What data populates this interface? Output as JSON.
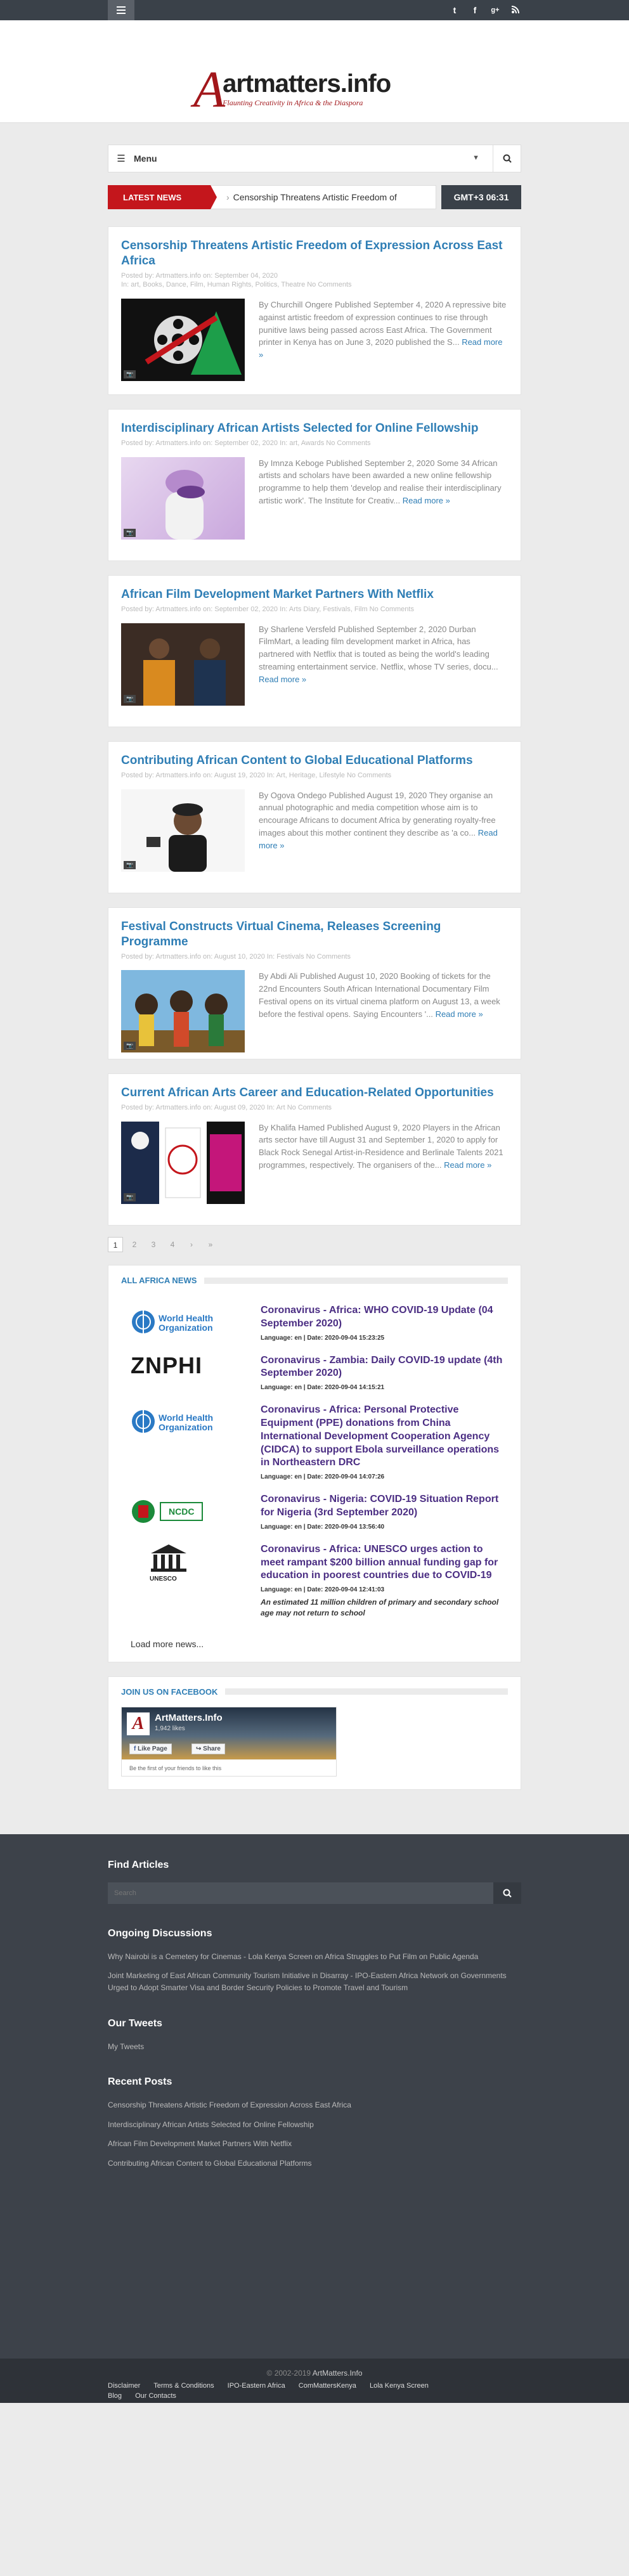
{
  "header": {
    "site_name": "artmatters.info",
    "tagline": "Flaunting Creativity in Africa & the Diaspora",
    "social": [
      "twitter-icon",
      "facebook-icon",
      "google-plus-icon",
      "rss-icon"
    ]
  },
  "nav": {
    "menu_label": "Menu"
  },
  "ticker": {
    "label": "LATEST NEWS",
    "text": "Censorship Threatens Artistic Freedom of",
    "time": "GMT+3 06:31"
  },
  "posts": [
    {
      "title": "Censorship Threatens Artistic Freedom of Expression Across East Africa",
      "meta1": "Posted by: Artmatters.info    on: September 04, 2020",
      "meta2": "In: art, Books, Dance, Film, Human Rights, Politics, Theatre    No Comments",
      "excerpt": "By Churchill Ongere Published September 4, 2020 A repressive bite against artistic freedom of expression continues to rise through punitive laws being passed across East Africa. The Government printer in Kenya has on June 3, 2020 published the S...",
      "more": "Read more »"
    },
    {
      "title": "Interdisciplinary African Artists Selected for Online Fellowship",
      "meta1": "Posted by: Artmatters.info    on: September 02, 2020    In: art, Awards    No Comments",
      "meta2": "",
      "excerpt": "By Imnza Keboge Published September 2, 2020 Some 34 African artists and scholars have been awarded a new online fellowship programme to help them 'develop and realise their interdisciplinary artistic work'. The Institute for Creativ...",
      "more": "Read more »"
    },
    {
      "title": "African Film Development Market Partners With Netflix",
      "meta1": "Posted by: Artmatters.info    on: September 02, 2020    In: Arts Diary, Festivals, Film    No Comments",
      "meta2": "",
      "excerpt": "By Sharlene Versfeld Published September 2, 2020 Durban FilmMart, a leading film development market in Africa, has partnered with Netflix that is touted as being the world's leading streaming entertainment service. Netflix, whose TV series, docu...",
      "more": "Read more »"
    },
    {
      "title": "Contributing African Content to Global Educational Platforms",
      "meta1": "Posted by: Artmatters.info    on: August 19, 2020    In: Art, Heritage, Lifestyle    No Comments",
      "meta2": "",
      "excerpt": "By Ogova Ondego Published August 19, 2020 They organise an annual photographic and media competition whose aim is to encourage Africans to document Africa by generating royalty-free images about this mother continent they describe as 'a co...",
      "more": "Read more »"
    },
    {
      "title": "Festival Constructs Virtual Cinema, Releases Screening Programme",
      "meta1": "Posted by: Artmatters.info    on: August 10, 2020    In: Festivals    No Comments",
      "meta2": "",
      "excerpt": "By Abdi Ali Published August 10, 2020 Booking of tickets for the 22nd Encounters South African International Documentary Film Festival opens on its virtual cinema platform on August 13, a week before the festival opens. Saying Encounters '...",
      "more": "Read more »"
    },
    {
      "title": "Current African Arts Career and Education-Related Opportunities",
      "meta1": "Posted by: Artmatters.info    on: August 09, 2020    In: Art    No Comments",
      "meta2": "",
      "excerpt": "By Khalifa Hamed Published August 9, 2020 Players in the African arts sector have till August 31 and September 1, 2020 to apply for Black Rock Senegal Artist-in-Residence and Berlinale Talents 2021 programmes, respectively. The organisers of the...",
      "more": "Read more »"
    }
  ],
  "pagination": [
    "1",
    "2",
    "3",
    "4",
    "›",
    "»"
  ],
  "all_africa": {
    "title": "ALL AFRICA NEWS",
    "items": [
      {
        "logo": "World Health Organization",
        "title": "Coronavirus - Africa: WHO COVID-19 Update (04 September 2020)",
        "meta": "Language: en | Date: 2020-09-04 15:23:25",
        "summary": ""
      },
      {
        "logo": "ZNPHI",
        "title": "Coronavirus - Zambia: Daily COVID-19 update (4th September 2020)",
        "meta": "Language: en | Date: 2020-09-04 14:15:21",
        "summary": ""
      },
      {
        "logo": "World Health Organization",
        "title": "Coronavirus - Africa: Personal Protective Equipment (PPE) donations from China International Development Cooperation Agency (CIDCA) to support Ebola surveillance operations in Northeastern DRC",
        "meta": "Language: en | Date: 2020-09-04 14:07:26",
        "summary": ""
      },
      {
        "logo": "NCDC",
        "title": "Coronavirus - Nigeria: COVID-19 Situation Report for Nigeria (3rd September 2020)",
        "meta": "Language: en | Date: 2020-09-04 13:56:40",
        "summary": ""
      },
      {
        "logo": "UNESCO",
        "title": "Coronavirus - Africa: UNESCO urges action to meet rampant $200 billion annual funding gap for education in poorest countries due to COVID-19",
        "meta": "Language: en | Date: 2020-09-04 12:41:03",
        "summary": "An estimated 11 million children of primary and secondary school age may not return to school"
      }
    ],
    "load_more": "Load more news..."
  },
  "facebook": {
    "title": "JOIN US ON FACEBOOK",
    "page": "ArtMatters.Info",
    "likes": "1,942 likes",
    "like_btn": "Like Page",
    "share_btn": "Share",
    "footer": "Be the first of your friends to like this"
  },
  "footer": {
    "find": "Find Articles",
    "search_placeholder": "Search",
    "ongoing": "Ongoing Discussions",
    "ongoing_links": [
      "Why Nairobi is a Cemetery for Cinemas - Lola Kenya Screen on Africa Struggles to Put Film on Public Agenda",
      "Joint Marketing of East African Community Tourism Initiative in Disarray - IPO-Eastern Africa Network on Governments Urged to Adopt Smarter Visa and Border Security Policies to Promote Travel and Tourism"
    ],
    "tweets": "Our Tweets",
    "my_tweets": "My Tweets",
    "recent": "Recent Posts",
    "recent_links": [
      "Censorship Threatens Artistic Freedom of Expression Across East Africa",
      "Interdisciplinary African Artists Selected for Online Fellowship",
      "African Film Development Market Partners With Netflix",
      "Contributing African Content to Global Educational Platforms"
    ],
    "copyright": "© 2002-2019",
    "copyright_site": "ArtMatters.Info",
    "bottom_links": [
      "Disclaimer",
      "Terms & Conditions",
      "IPO-Eastern Africa",
      "ComMattersKenya",
      "Lola Kenya Screen",
      "Blog",
      "Our Contacts"
    ]
  }
}
